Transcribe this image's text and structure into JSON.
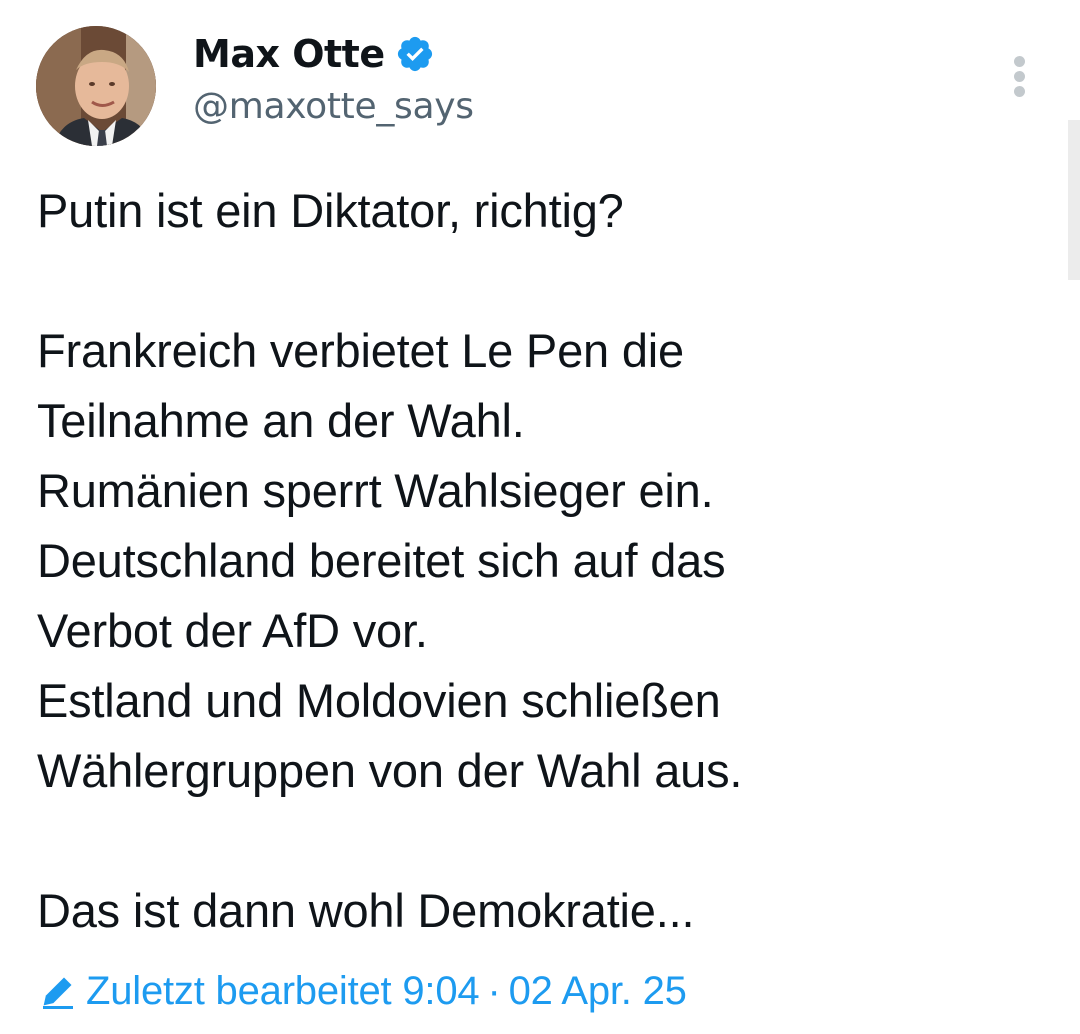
{
  "author": {
    "display_name": "Max Otte",
    "handle": "@maxotte_says",
    "verified_icon": "verified-badge-icon",
    "verified_color": "#1d9bf0"
  },
  "tweet": {
    "paragraphs": [
      [
        "Putin ist ein Diktator, richtig?"
      ],
      [
        "Frankreich verbietet Le Pen die",
        "Teilnahme an der Wahl.",
        "Rumänien sperrt Wahlsieger ein.",
        "Deutschland bereitet sich auf das",
        "Verbot der AfD vor.",
        "Estland und Moldovien schließen",
        "Wählergruppen von der Wahl aus."
      ],
      [
        "Das ist dann wohl Demokratie..."
      ]
    ]
  },
  "meta": {
    "edit_icon": "pencil-icon",
    "edited_label": "Zuletzt bearbeitet 9:04",
    "separator": "·",
    "date": "02 Apr. 25",
    "accent_color": "#1d9bf0"
  },
  "more_icon": "more-vertical-icon"
}
